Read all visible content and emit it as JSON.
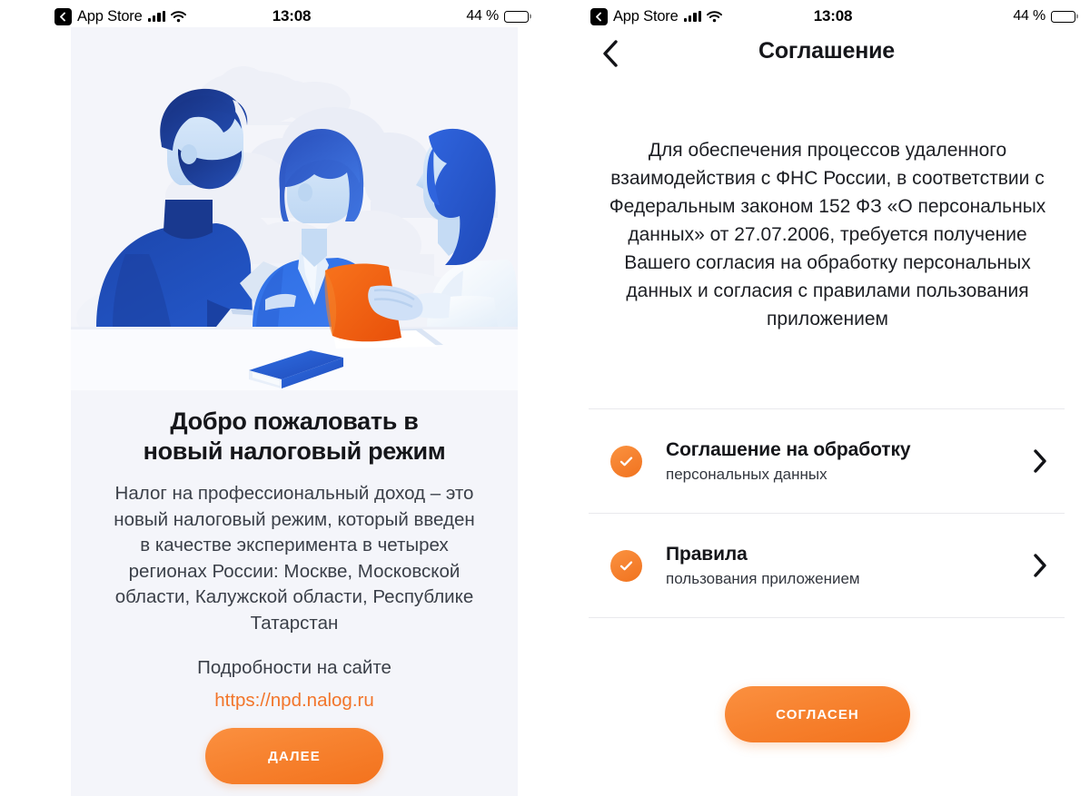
{
  "status_bar": {
    "back_app_label": "App Store",
    "time": "13:08",
    "battery_percent": "44 %",
    "battery_level": 44,
    "signal_icon": "cellular-bars-icon",
    "wifi_icon": "wifi-icon",
    "battery_icon": "battery-icon",
    "back_badge_icon": "back-chevron-badge-icon"
  },
  "left_screen": {
    "illustration_name": "three-people-meeting-illustration",
    "title": "Добро пожаловать в\nновый налоговый режим",
    "title_line1": "Добро пожаловать в",
    "title_line2": "новый налоговый режим",
    "description": "Налог на профессиональный доход – это новый налоговый режим, который введен в качестве эксперимента в четырех регионах России: Москве, Московской области, Калужской области, Республике Татарстан",
    "details_label": "Подробности на сайте",
    "details_link": "https://npd.nalog.ru",
    "next_button": "ДАЛЕЕ"
  },
  "right_screen": {
    "nav_title": "Соглашение",
    "back_icon": "chevron-left-icon",
    "body_text": "Для обеспечения процессов удаленного взаимодействия с ФНС России, в соответствии с Федеральным законом 152 ФЗ «О персональных данных» от 27.07.2006, требуется получение Вашего согласия на обработку персональных данных и согласия с правилами пользования приложением",
    "consents": [
      {
        "title": "Соглашение на обработку",
        "subtitle": "персональных данных",
        "checked": true,
        "check_icon": "check-circle-icon",
        "chevron_icon": "chevron-right-icon"
      },
      {
        "title": "Правила",
        "subtitle": "пользования приложением",
        "checked": true,
        "check_icon": "check-circle-icon",
        "chevron_icon": "chevron-right-icon"
      }
    ],
    "agree_button": "СОГЛАСЕН"
  },
  "colors": {
    "accent_orange": "#f3721d",
    "accent_orange_light": "#fb9040",
    "panel_background": "#f4f5fa",
    "text_primary": "#15161a",
    "text_secondary": "#3b4049",
    "divider": "#e9e9ed",
    "illustration_dark_blue": "#1b3a97",
    "illustration_blue": "#2f6fe4",
    "illustration_light_blue": "#cfe0f7",
    "illustration_orange": "#ef5d10"
  }
}
